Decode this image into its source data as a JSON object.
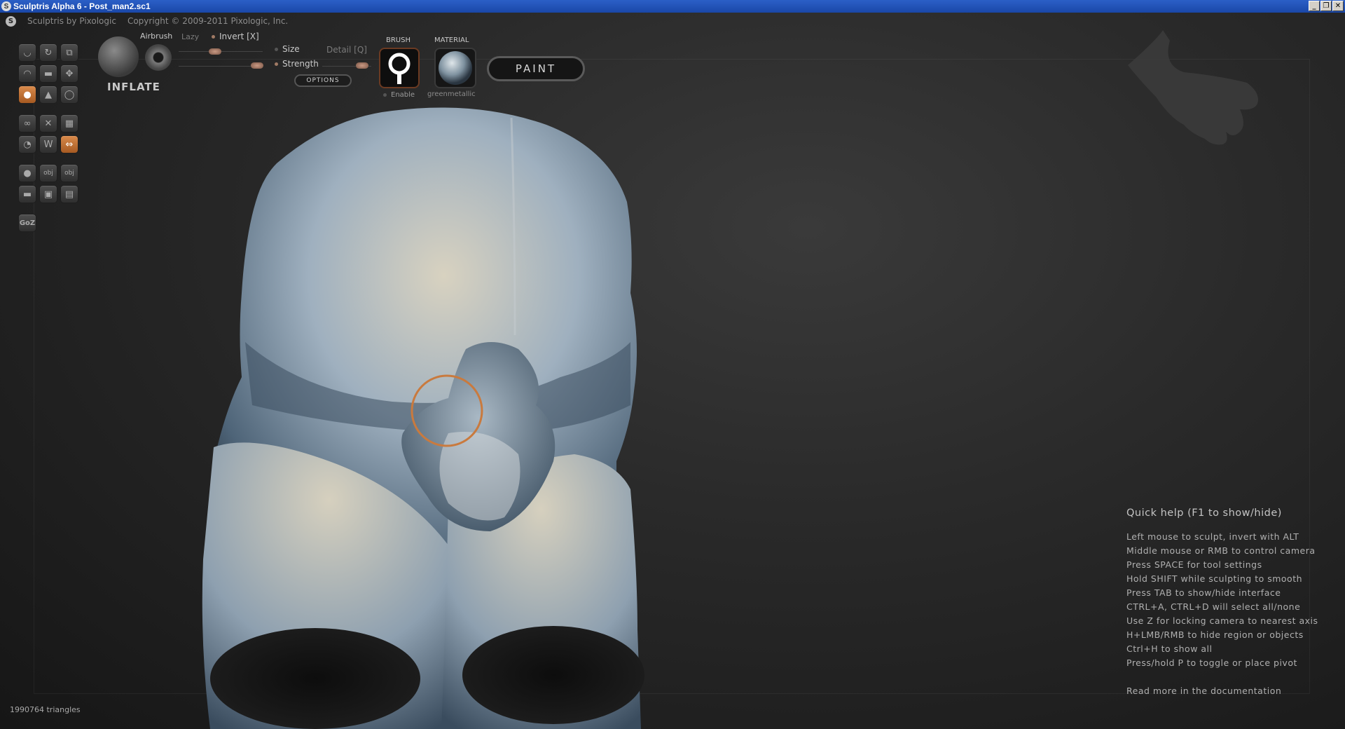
{
  "window": {
    "title": "Sculptris Alpha 6 - Post_man2.sc1",
    "buttons": [
      "_",
      "❐",
      "✕"
    ]
  },
  "appbar": {
    "app_name": "Sculptris by Pixologic",
    "copyright": "Copyright © 2009-2011 Pixologic, Inc."
  },
  "toolbar": {
    "tools": [
      {
        "name": "crease-tool",
        "glyph": "◡",
        "active": false
      },
      {
        "name": "rotate-tool",
        "glyph": "↻",
        "active": false
      },
      {
        "name": "scale-tool",
        "glyph": "⧉",
        "active": false
      },
      {
        "name": "draw-tool",
        "glyph": "◠",
        "active": false
      },
      {
        "name": "flatten-tool",
        "glyph": "▬",
        "active": false
      },
      {
        "name": "grab-tool",
        "glyph": "✥",
        "active": false
      },
      {
        "name": "inflate-tool",
        "glyph": "●",
        "active": true
      },
      {
        "name": "pinch-tool",
        "glyph": "▲",
        "active": false
      },
      {
        "name": "smooth-tool",
        "glyph": "◯",
        "active": false
      },
      {
        "name": "symmetry-tool",
        "glyph": "∞",
        "active": false
      },
      {
        "name": "wireframe-tool",
        "glyph": "✕",
        "active": false
      },
      {
        "name": "grid-tool",
        "glyph": "▦",
        "active": false
      },
      {
        "name": "reduce-tool",
        "glyph": "◔",
        "active": false
      },
      {
        "name": "subdivide-tool",
        "glyph": "W",
        "active": false
      },
      {
        "name": "mirror-tool",
        "glyph": "⇔",
        "active": true
      },
      {
        "name": "new-sphere-tool",
        "glyph": "●",
        "active": false
      },
      {
        "name": "import-tool",
        "glyph": "obj",
        "active": false
      },
      {
        "name": "export-tool",
        "glyph": "obj",
        "active": false
      },
      {
        "name": "plane-tool",
        "glyph": "▬",
        "active": false
      },
      {
        "name": "open-tool",
        "glyph": "▣",
        "active": false
      },
      {
        "name": "save-tool",
        "glyph": "▤",
        "active": false
      },
      {
        "name": "goz-tool",
        "glyph": "GoZ",
        "active": false
      }
    ]
  },
  "panel": {
    "tool_name": "INFLATE",
    "airbrush_label": "Airbrush",
    "lazy_label": "Lazy",
    "invert_label": "Invert [X]",
    "size_label": "Size",
    "detail_label": "Detail [Q]",
    "strength_label": "Strength",
    "options_label": "OPTIONS",
    "brush_label": "BRUSH",
    "material_label": "MATERIAL",
    "enable_label": "Enable",
    "material_name": "greenmetallic",
    "paint_label": "PAINT"
  },
  "quickhelp": {
    "title": "Quick help (F1 to show/hide)",
    "lines": [
      "Left mouse to sculpt, invert with ALT",
      "Middle mouse or RMB to control camera",
      "Press SPACE for tool settings",
      "Hold SHIFT while sculpting to smooth",
      "Press TAB to show/hide interface",
      "CTRL+A, CTRL+D will select all/none",
      "Use Z for locking camera to nearest axis",
      "H+LMB/RMB to hide region or objects",
      "Ctrl+H to show all",
      "Press/hold P to toggle or place pivot"
    ],
    "doc_link": "Read more in the documentation"
  },
  "status": {
    "triangles": "1990764 triangles"
  },
  "colors": {
    "accent": "#c97a3e",
    "model": "#b8c4cc"
  }
}
